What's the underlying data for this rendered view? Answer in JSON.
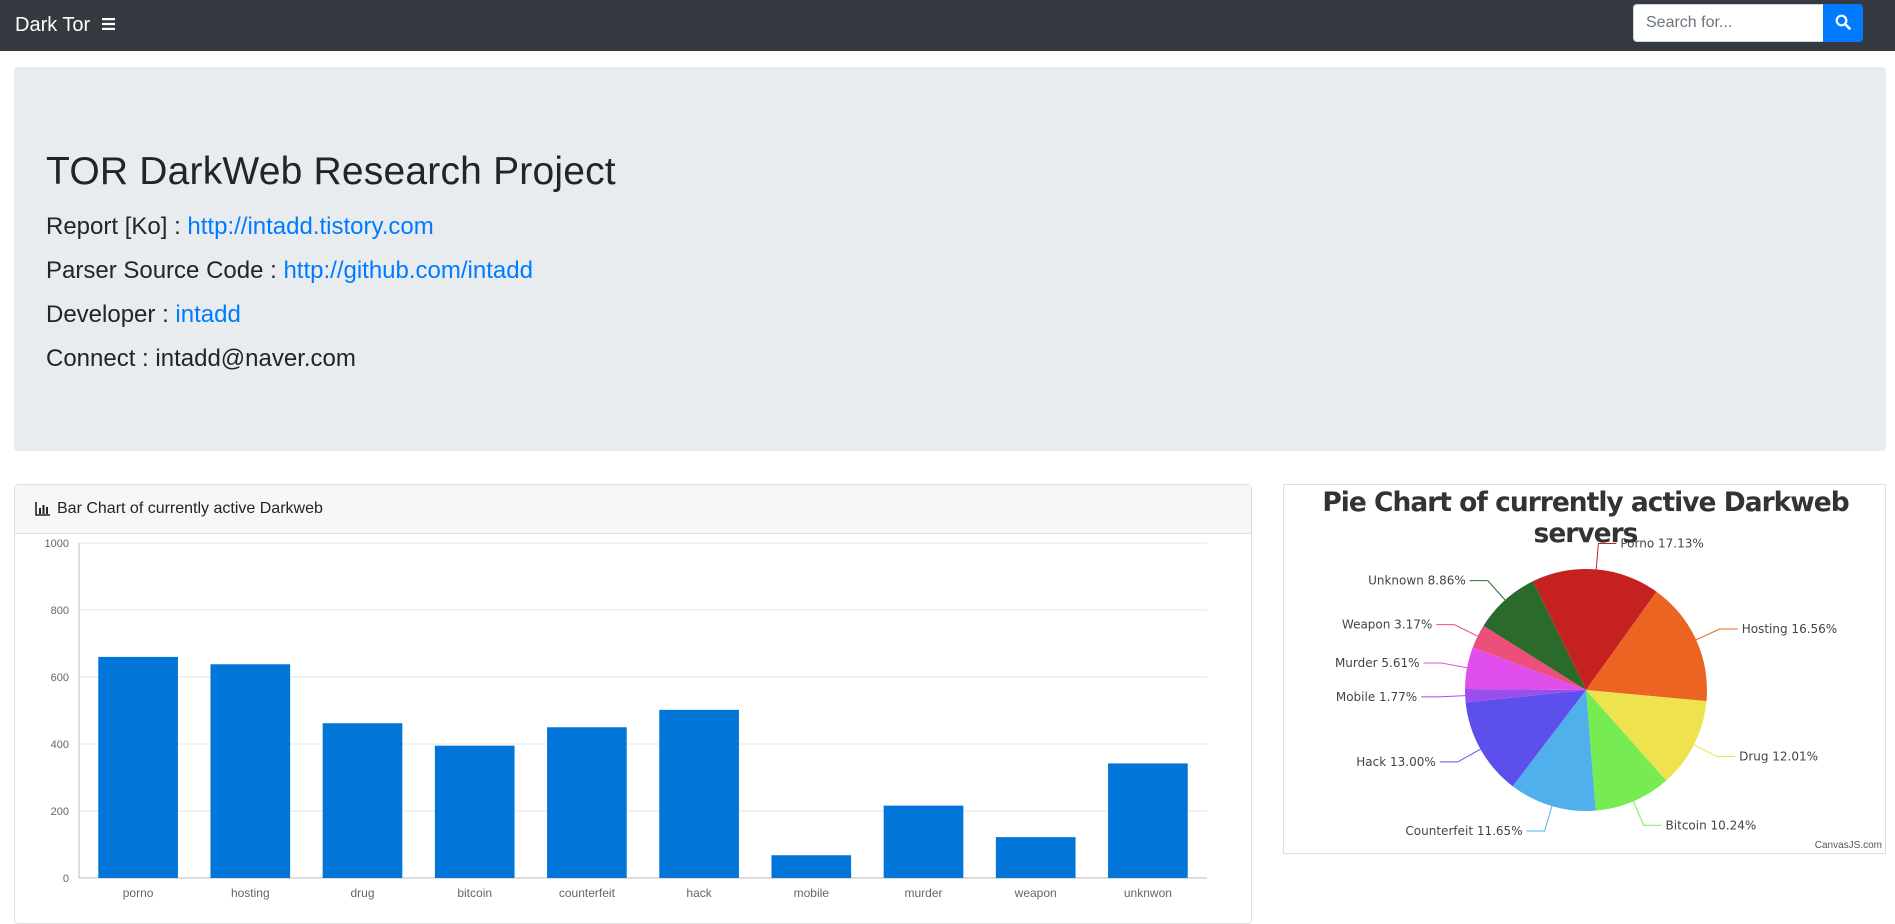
{
  "navbar": {
    "brand": "Dark Tor",
    "menu_icon": "bars-icon",
    "search_placeholder": "Search for...",
    "search_icon": "search-icon"
  },
  "jumbotron": {
    "title": "TOR DarkWeb Research Project",
    "report_label": "Report [Ko] : ",
    "report_link": "http://intadd.tistory.com",
    "source_label": "Parser Source Code : ",
    "source_link": "http://github.com/intadd",
    "developer_label": "Developer : ",
    "developer_link": "intadd",
    "connect_label": "Connect : ",
    "connect_value": "intadd@naver.com"
  },
  "bar_card": {
    "header": "Bar Chart of currently active Darkweb",
    "icon": "bar-chart-icon"
  },
  "pie_card": {
    "title": "Pie Chart of currently active Darkweb servers",
    "credit": "CanvasJS.com"
  },
  "colors": {
    "bar": "#0275d8",
    "navbar": "#343a40",
    "jumbotron": "#e9ecef",
    "link": "#007bff"
  },
  "chart_data": [
    {
      "type": "bar",
      "categories": [
        "porno",
        "hosting",
        "drug",
        "bitcoin",
        "counterfeit",
        "hack",
        "mobile",
        "murder",
        "weapon",
        "unknwon"
      ],
      "values": [
        660,
        638,
        462,
        395,
        450,
        502,
        68,
        216,
        122,
        342
      ],
      "ylim": [
        0,
        1000
      ],
      "yticks": [
        0,
        200,
        400,
        600,
        800,
        1000
      ],
      "grid": true
    },
    {
      "type": "pie",
      "title": "Pie Chart of currently active Darkweb servers",
      "slices": [
        {
          "label": "Porno 17.13%",
          "value": 17.13,
          "color": "#c62121"
        },
        {
          "label": "Hosting 16.56%",
          "value": 16.56,
          "color": "#ec6421"
        },
        {
          "label": "Drug 12.01%",
          "value": 12.01,
          "color": "#eee34f"
        },
        {
          "label": "Bitcoin 10.24%",
          "value": 10.24,
          "color": "#76ec52"
        },
        {
          "label": "Counterfeit 11.65%",
          "value": 11.65,
          "color": "#4fb0ec"
        },
        {
          "label": "Hack 13.00%",
          "value": 13.0,
          "color": "#5c4fec"
        },
        {
          "label": "Mobile 1.77%",
          "value": 1.77,
          "color": "#9a4fec"
        },
        {
          "label": "Murder 5.61%",
          "value": 5.61,
          "color": "#e04fec"
        },
        {
          "label": "Weapon 3.17%",
          "value": 3.17,
          "color": "#ec4f7a"
        },
        {
          "label": "Unknown 8.86%",
          "value": 8.86,
          "color": "#2a6a2a"
        }
      ]
    }
  ]
}
